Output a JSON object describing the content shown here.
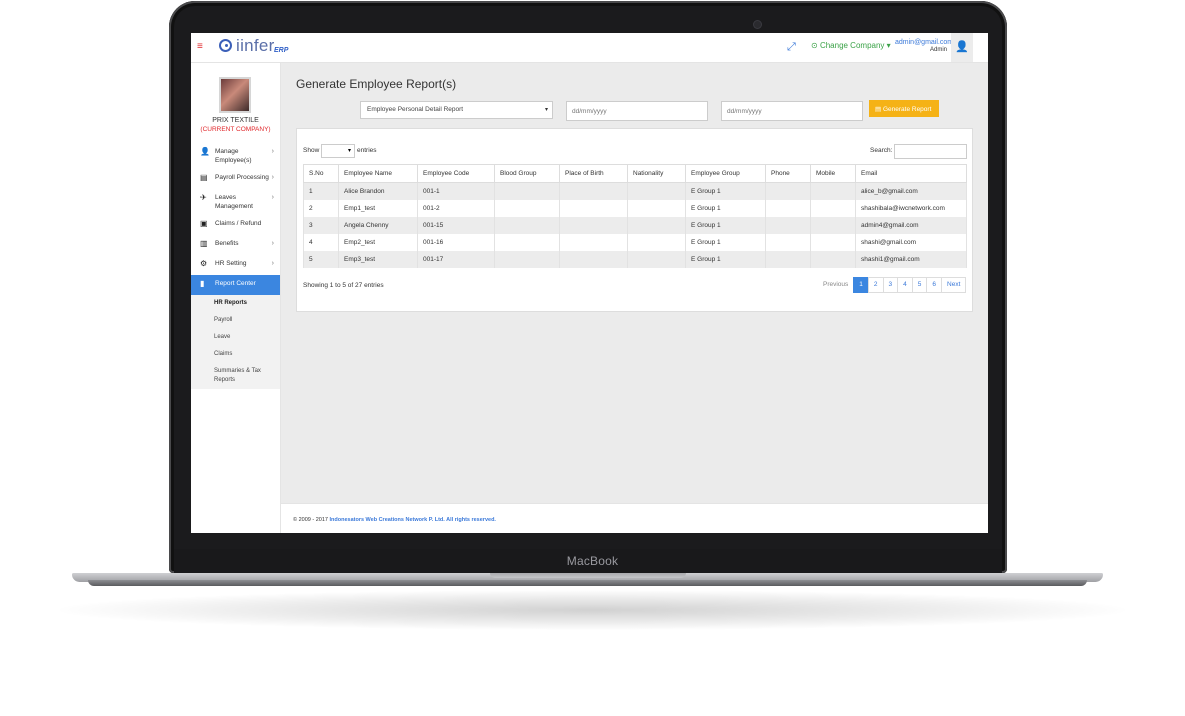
{
  "device": {
    "brand_label": "MacBook"
  },
  "topbar": {
    "logo_text": "iinfer",
    "logo_sub": "ERP",
    "change_company_label": "Change Company",
    "user_email": "admin@gmail.com",
    "user_role": "Admin",
    "icons": {
      "menu": "hamburger-icon",
      "expand": "expand-icon",
      "user": "user-icon"
    }
  },
  "sidebar": {
    "company_name": "PRIX TEXTILE",
    "company_tag": "(CURRENT COMPANY)",
    "items": [
      {
        "label": "Manage Employee(s)",
        "icon": "user-icon",
        "has_chevron": true
      },
      {
        "label": "Payroll Processing",
        "icon": "payroll-icon",
        "has_chevron": true
      },
      {
        "label": "Leaves Management",
        "icon": "plane-icon",
        "has_chevron": true
      },
      {
        "label": "Claims / Refund",
        "icon": "money-icon",
        "has_chevron": false
      },
      {
        "label": "Benefits",
        "icon": "gift-icon",
        "has_chevron": true
      },
      {
        "label": "HR Setting",
        "icon": "gear-icon",
        "has_chevron": true
      },
      {
        "label": "Report Center",
        "icon": "bar-chart-icon",
        "has_chevron": true,
        "active": true
      }
    ],
    "subitems": [
      {
        "label": "HR Reports",
        "active": true
      },
      {
        "label": "Payroll"
      },
      {
        "label": "Leave"
      },
      {
        "label": "Claims"
      },
      {
        "label": "Summaries & Tax Reports"
      }
    ]
  },
  "main": {
    "title": "Generate Employee Report(s)",
    "report_select": "Employee Personal Detail Report",
    "date_from_placeholder": "dd/mm/yyyy",
    "date_to_placeholder": "dd/mm/yyyy",
    "generate_button": "Generate Report"
  },
  "table": {
    "show_label": "Show",
    "entries_label": "entries",
    "search_label": "Search:",
    "columns": [
      "S.No",
      "Employee Name",
      "Employee Code",
      "Blood Group",
      "Place of Birth",
      "Nationality",
      "Employee Group",
      "Phone",
      "Mobile",
      "Email"
    ],
    "rows": [
      [
        "1",
        "Alice Brandon",
        "001-1",
        "",
        "",
        "",
        "E Group 1",
        "",
        "",
        "alice_b@gmail.com"
      ],
      [
        "2",
        "Emp1_test",
        "001-2",
        "",
        "",
        "",
        "E Group 1",
        "",
        "",
        "shashibala@iwcnetwork.com"
      ],
      [
        "3",
        "Angela Chenny",
        "001-15",
        "",
        "",
        "",
        "E Group 1",
        "",
        "",
        "admin4@gmail.com"
      ],
      [
        "4",
        "Emp2_test",
        "001-16",
        "",
        "",
        "",
        "E Group 1",
        "",
        "",
        "shashi@gmail.com"
      ],
      [
        "5",
        "Emp3_test",
        "001-17",
        "",
        "",
        "",
        "E Group 1",
        "",
        "",
        "shashi1@gmail.com"
      ]
    ],
    "info": "Showing 1 to 5 of 27 entries",
    "pagination": {
      "previous": "Previous",
      "pages": [
        "1",
        "2",
        "3",
        "4",
        "5",
        "6"
      ],
      "current": "1",
      "next": "Next"
    }
  },
  "footer": {
    "prefix": "© 2009 - 2017",
    "org": "Indonesators Web Creations Network P. Ltd. All rights reserved."
  },
  "colors": {
    "primary": "#3b86e0",
    "accent_red": "#e0262a",
    "warning": "#f5b216",
    "success": "#3aa247"
  }
}
